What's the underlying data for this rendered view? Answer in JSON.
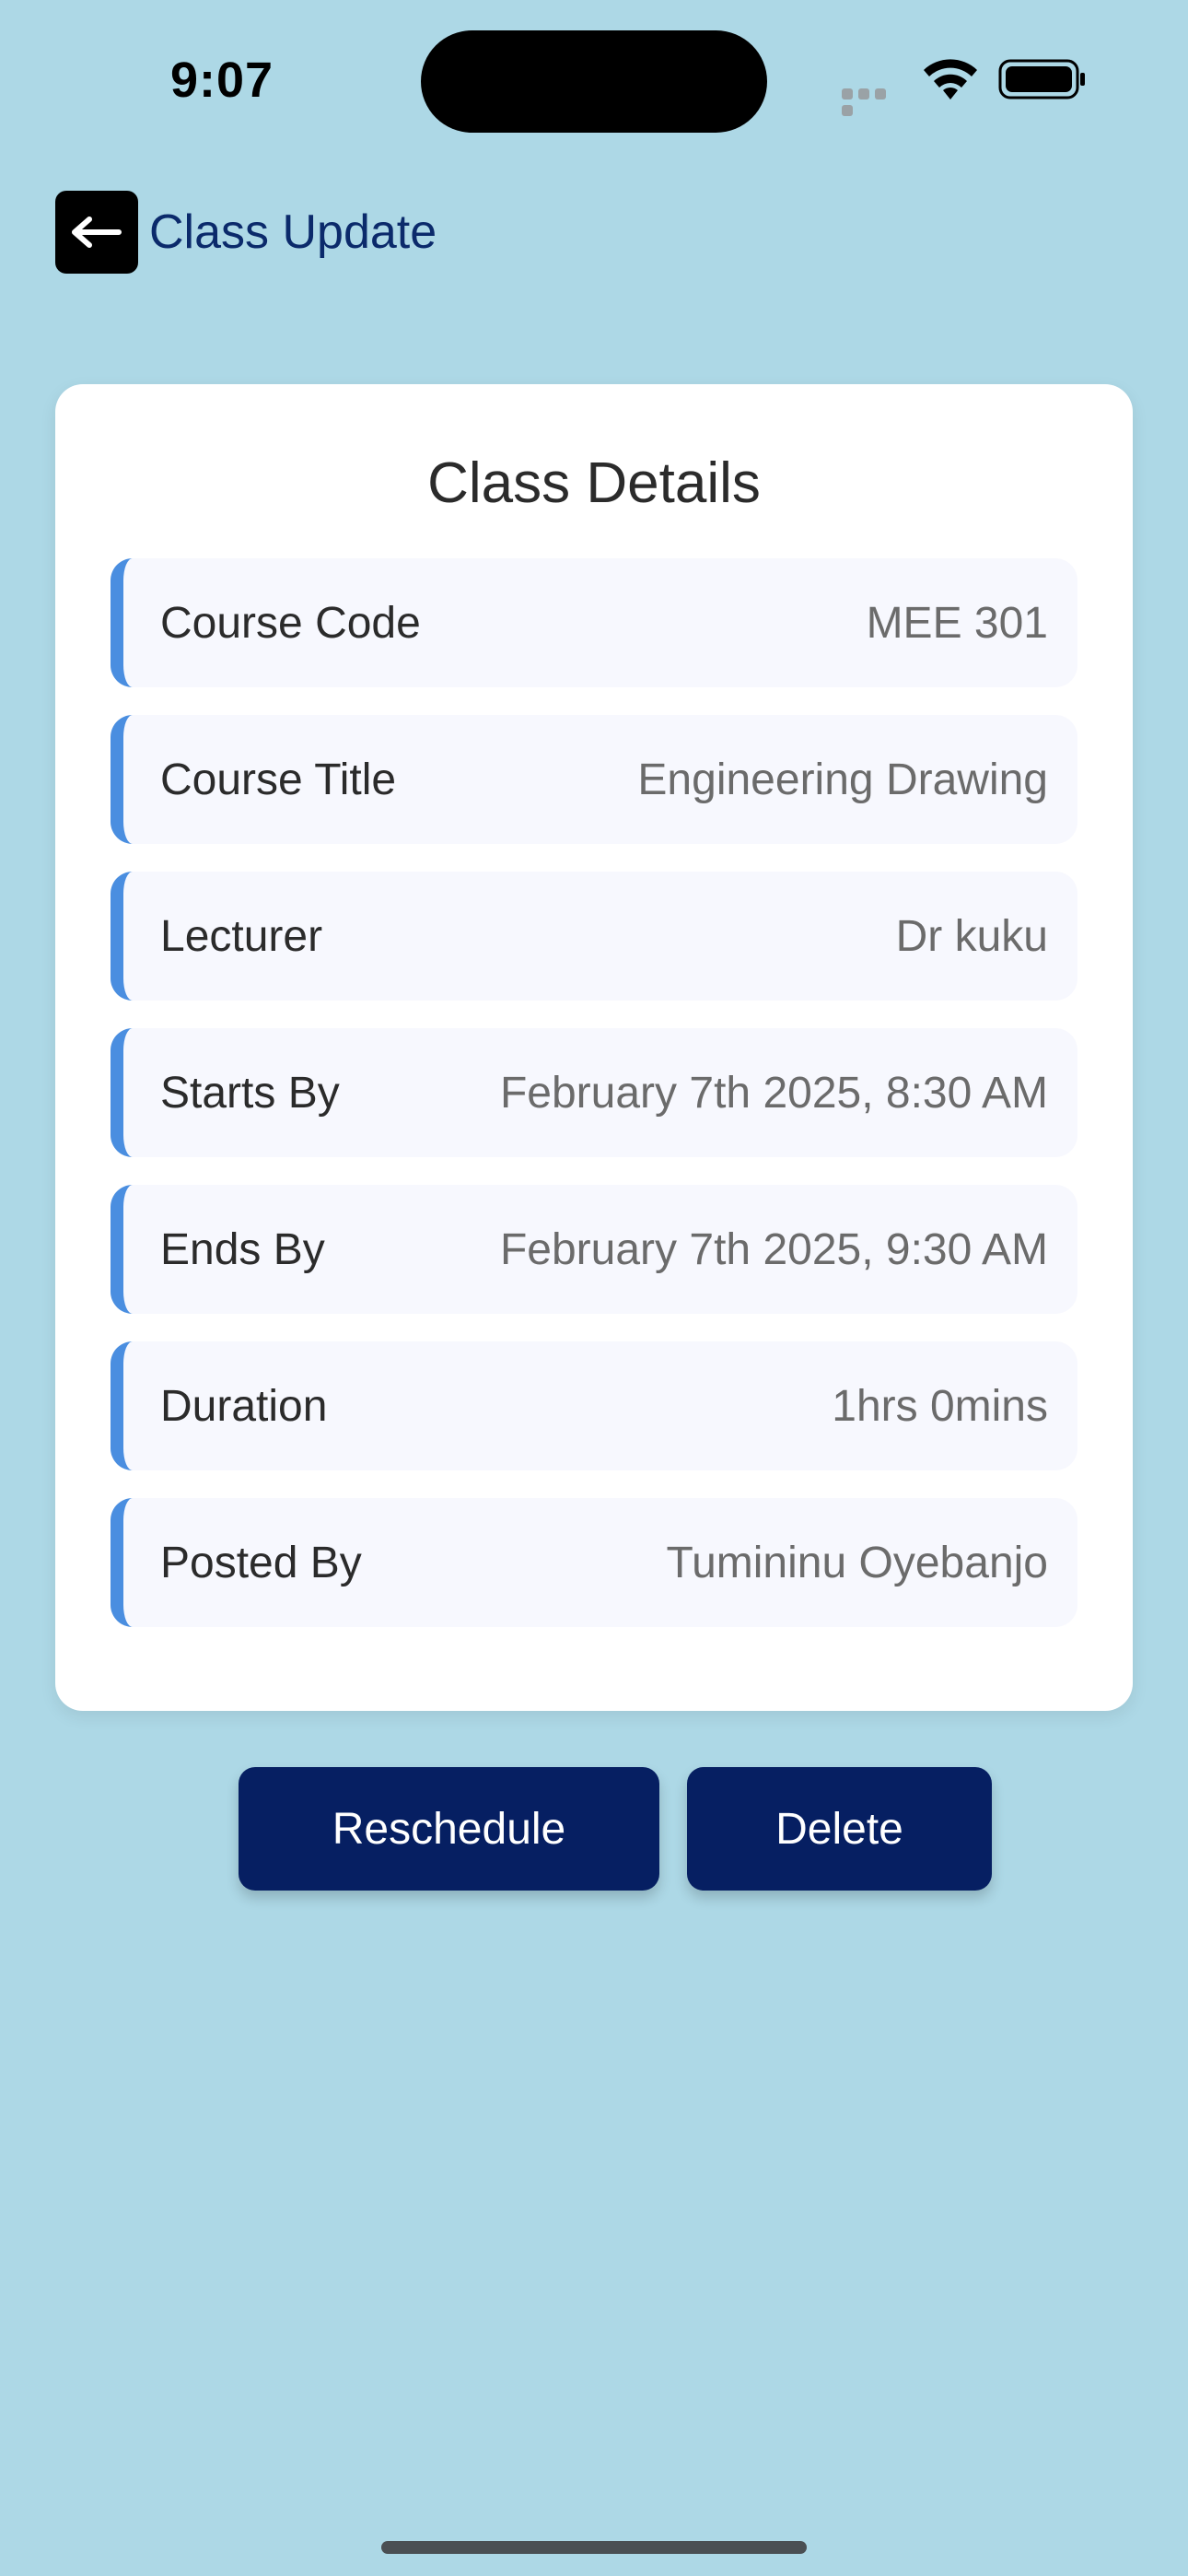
{
  "status_bar": {
    "time": "9:07"
  },
  "header": {
    "back_icon": "arrow-left-icon",
    "title": "Class Update"
  },
  "card": {
    "title": "Class Details",
    "rows": [
      {
        "label": "Course Code",
        "value": "MEE 301"
      },
      {
        "label": "Course Title",
        "value": "Engineering Drawing"
      },
      {
        "label": "Lecturer",
        "value": "Dr kuku"
      },
      {
        "label": "Starts By",
        "value": "February 7th 2025, 8:30 AM"
      },
      {
        "label": "Ends By",
        "value": "February 7th 2025, 9:30 AM"
      },
      {
        "label": "Duration",
        "value": "1hrs 0mins"
      },
      {
        "label": "Posted By",
        "value": "Tumininu Oyebanjo"
      }
    ]
  },
  "actions": {
    "reschedule_label": "Reschedule",
    "delete_label": "Delete"
  },
  "colors": {
    "background": "#ADD8E6",
    "accent": "#4A8EE0",
    "button": "#061F62",
    "header_text": "#0B2A6B"
  }
}
